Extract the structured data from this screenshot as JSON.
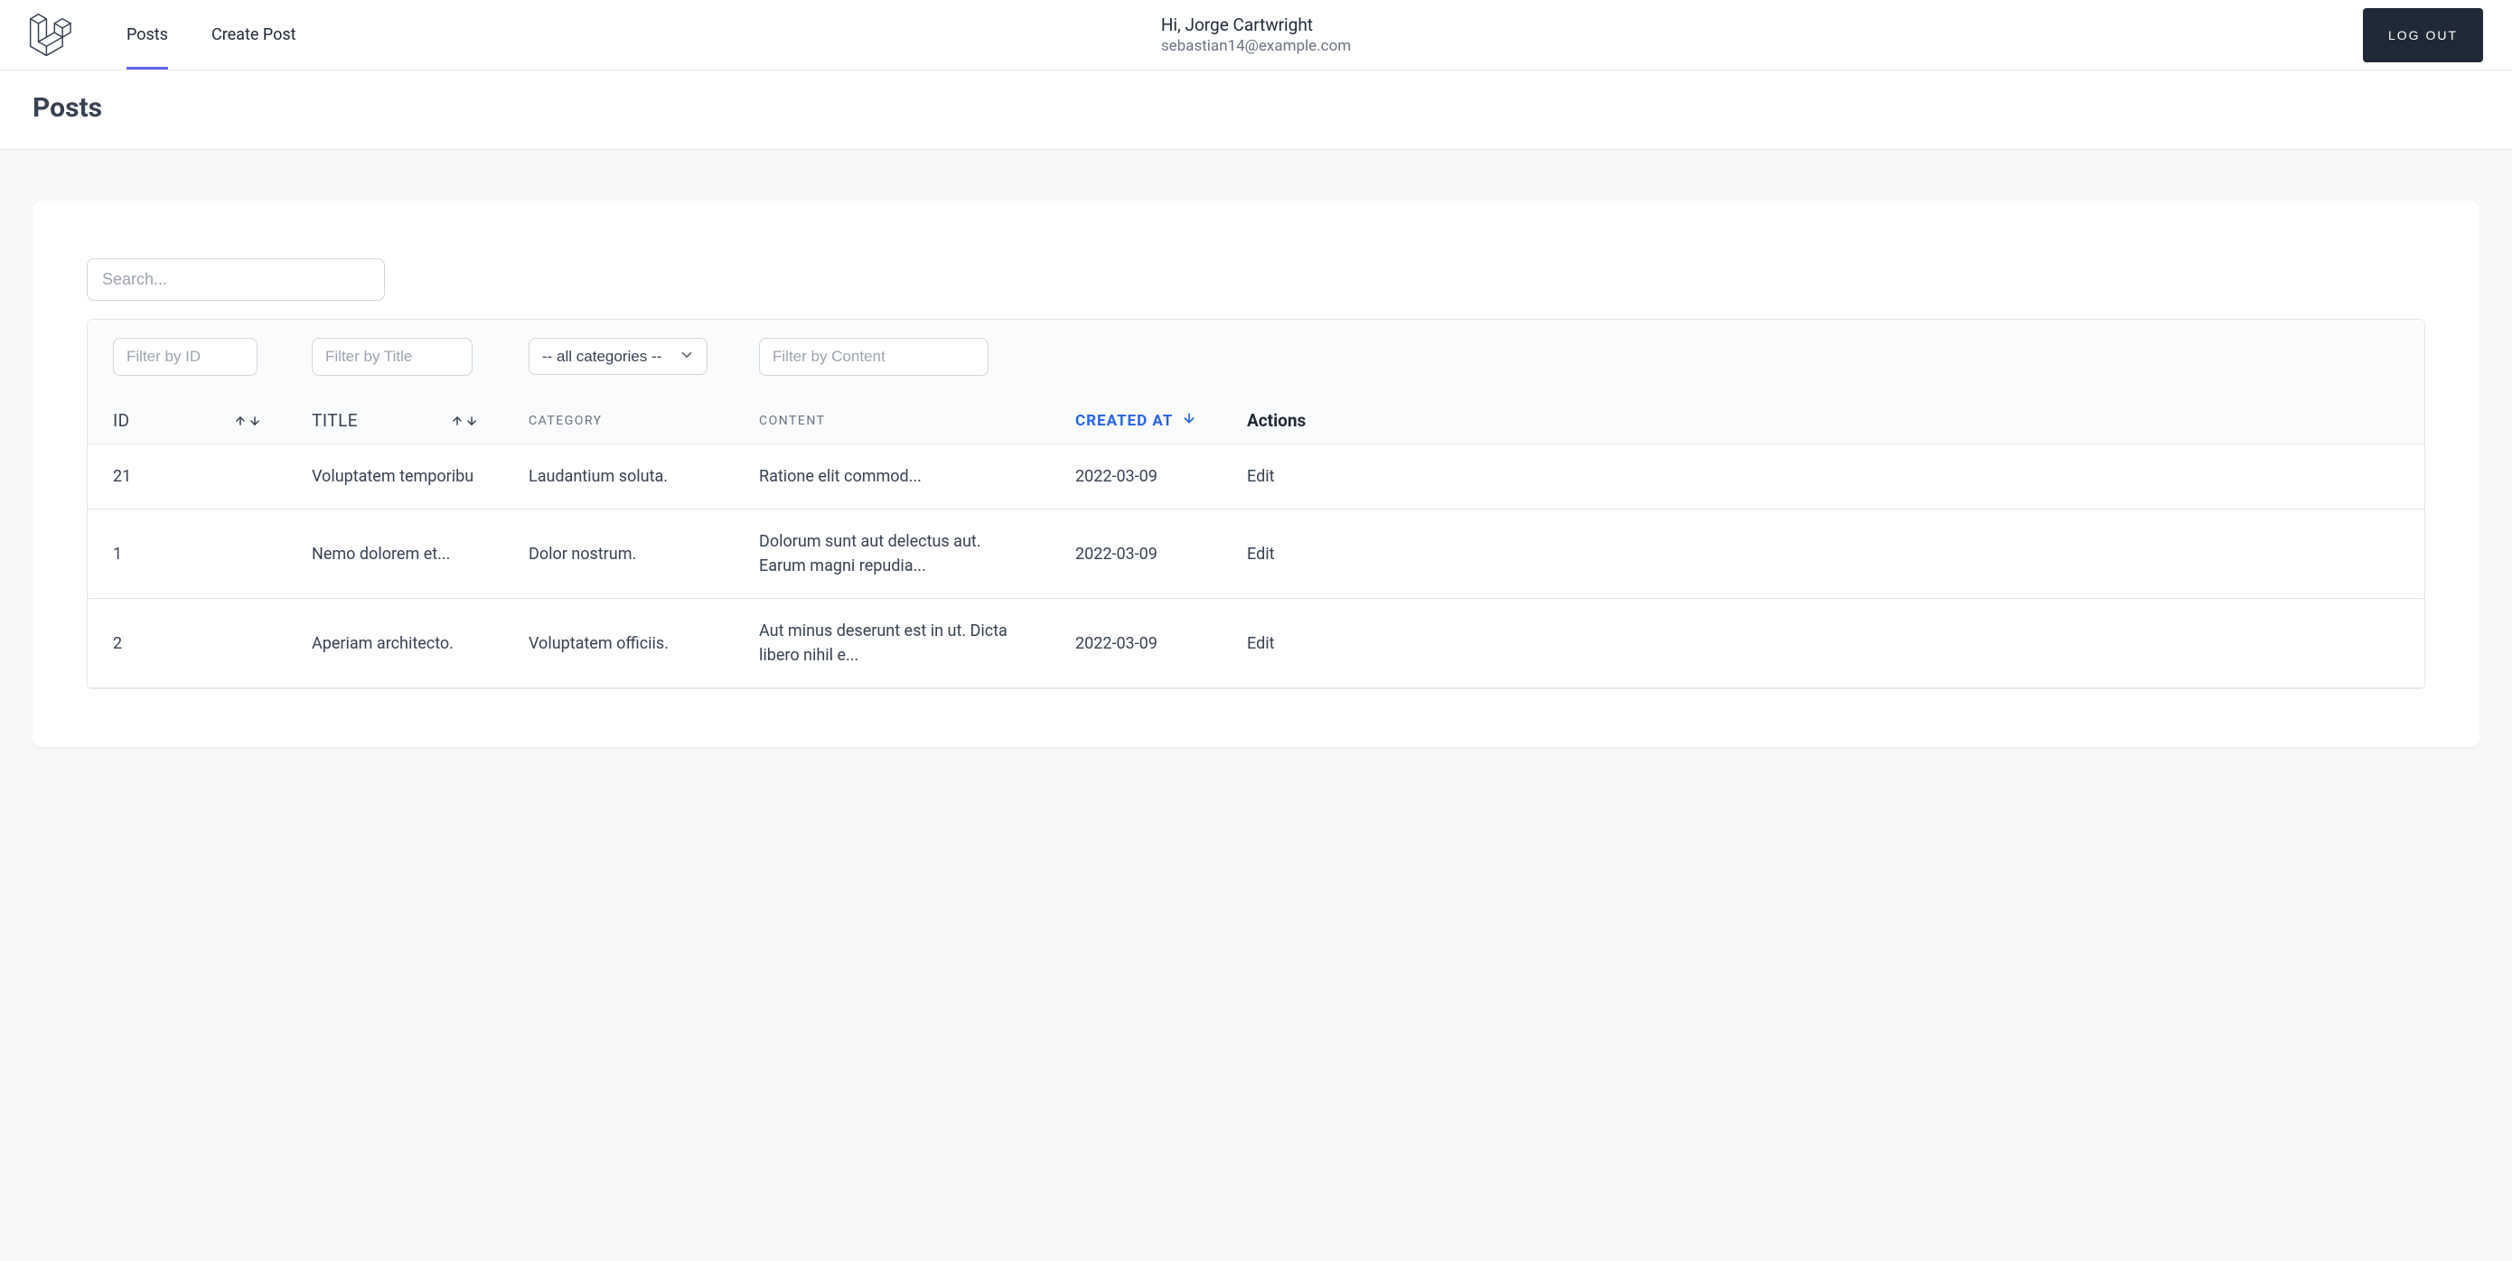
{
  "nav": {
    "posts": "Posts",
    "create": "Create Post"
  },
  "user": {
    "greeting": "Hi, Jorge Cartwright",
    "email": "sebastian14@example.com"
  },
  "logout": "LOG OUT",
  "page_title": "Posts",
  "search_placeholder": "Search...",
  "filters": {
    "id_placeholder": "Filter by ID",
    "title_placeholder": "Filter by Title",
    "category_selected": "-- all categories --",
    "content_placeholder": "Filter by Content"
  },
  "columns": {
    "id": "ID",
    "title": "TITLE",
    "category": "CATEGORY",
    "content": "CONTENT",
    "created_at": "CREATED AT",
    "actions": "Actions"
  },
  "edit_label": "Edit",
  "rows": [
    {
      "id": "21",
      "title": "Voluptatem temporibu",
      "category": "Laudantium soluta.",
      "content": "Ratione elit commod...",
      "created_at": "2022-03-09"
    },
    {
      "id": "1",
      "title": "Nemo dolorem et...",
      "category": "Dolor nostrum.",
      "content": "Dolorum sunt aut delectus aut. Earum magni repudia...",
      "created_at": "2022-03-09"
    },
    {
      "id": "2",
      "title": "Aperiam architecto.",
      "category": "Voluptatem officiis.",
      "content": "Aut minus deserunt est in ut. Dicta libero nihil e...",
      "created_at": "2022-03-09"
    }
  ]
}
